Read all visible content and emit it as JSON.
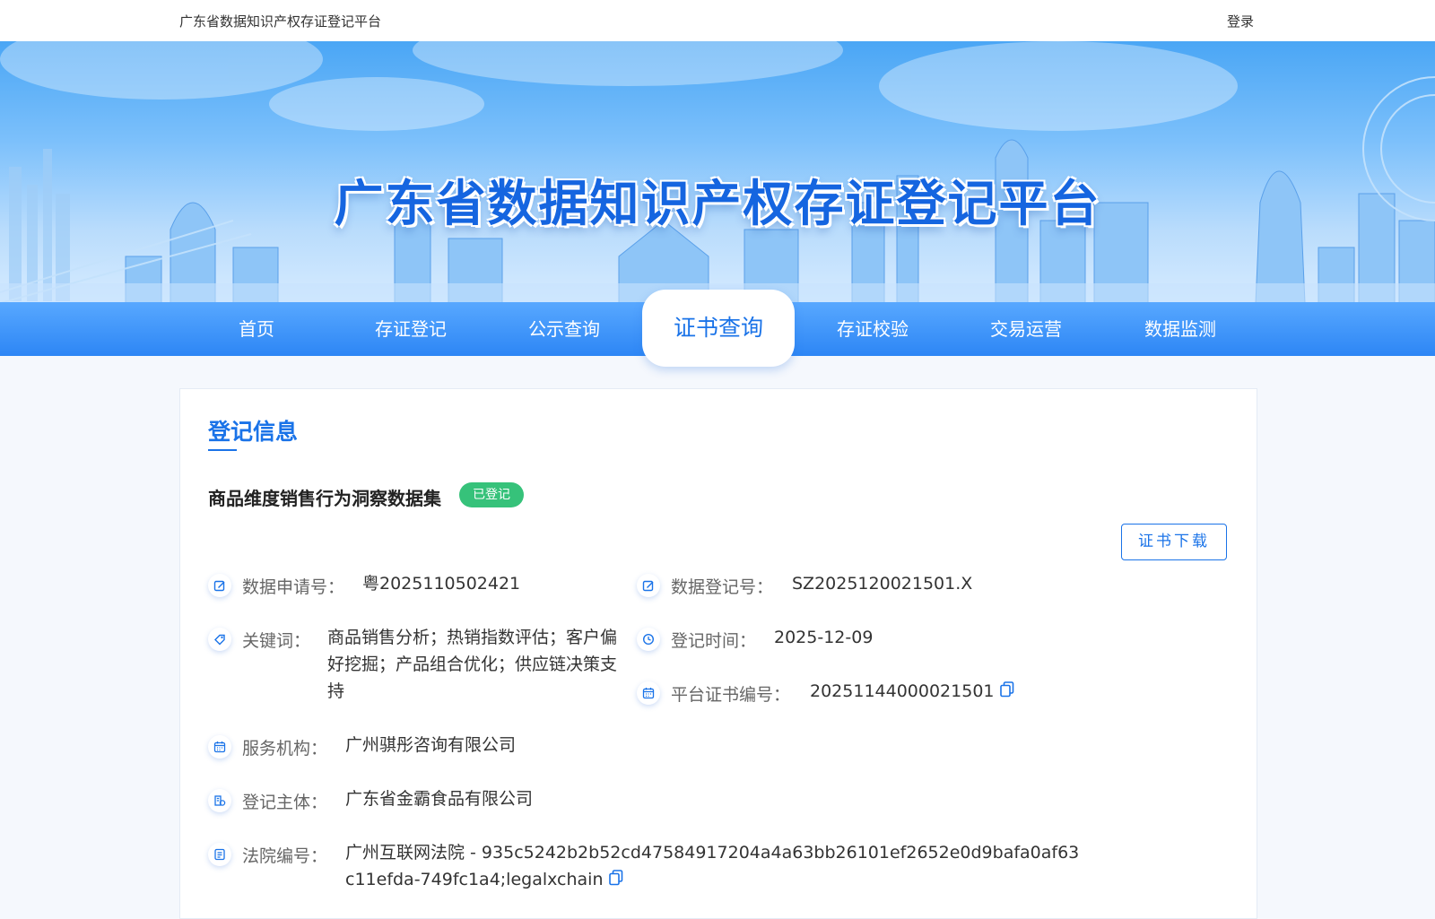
{
  "header": {
    "site_name": "广东省数据知识产权存证登记平台",
    "login": "登录"
  },
  "banner": {
    "title": "广东省数据知识产权存证登记平台"
  },
  "nav": {
    "items": [
      {
        "label": "首页",
        "active": false
      },
      {
        "label": "存证登记",
        "active": false
      },
      {
        "label": "公示查询",
        "active": false
      },
      {
        "label": "证书查询",
        "active": true
      },
      {
        "label": "存证校验",
        "active": false
      },
      {
        "label": "交易运营",
        "active": false
      },
      {
        "label": "数据监测",
        "active": false
      }
    ]
  },
  "registration": {
    "section_title": "登记信息",
    "dataset_name": "商品维度销售行为洞察数据集",
    "status_badge": "已登记",
    "download_button": "证书下载",
    "fields": {
      "application_no": {
        "label": "数据申请号：",
        "value": "粤2025110502421"
      },
      "registration_no": {
        "label": "数据登记号：",
        "value": "SZ2025120021501.X"
      },
      "keywords": {
        "label": "关键词：",
        "value": "商品销售分析；热销指数评估；客户偏好挖掘；产品组合优化；供应链决策支持"
      },
      "registration_time": {
        "label": "登记时间：",
        "value": "2025-12-09"
      },
      "certificate_no": {
        "label": "平台证书编号：",
        "value": "20251144000021501"
      },
      "service_org": {
        "label": "服务机构：",
        "value": "广州骐彤咨询有限公司"
      },
      "registrant": {
        "label": "登记主体：",
        "value": "广东省金霸食品有限公司"
      },
      "court_no": {
        "label": "法院编号：",
        "value": "广州互联网法院 - 935c5242b2b52cd47584917204a4a63bb26101ef2652e0d9bafa0af63c11efda-749fc1a4;legalxchain"
      }
    }
  },
  "colors": {
    "primary": "#1a73e8",
    "badge_green": "#36c27a",
    "nav_blue": "#2d86f5"
  }
}
